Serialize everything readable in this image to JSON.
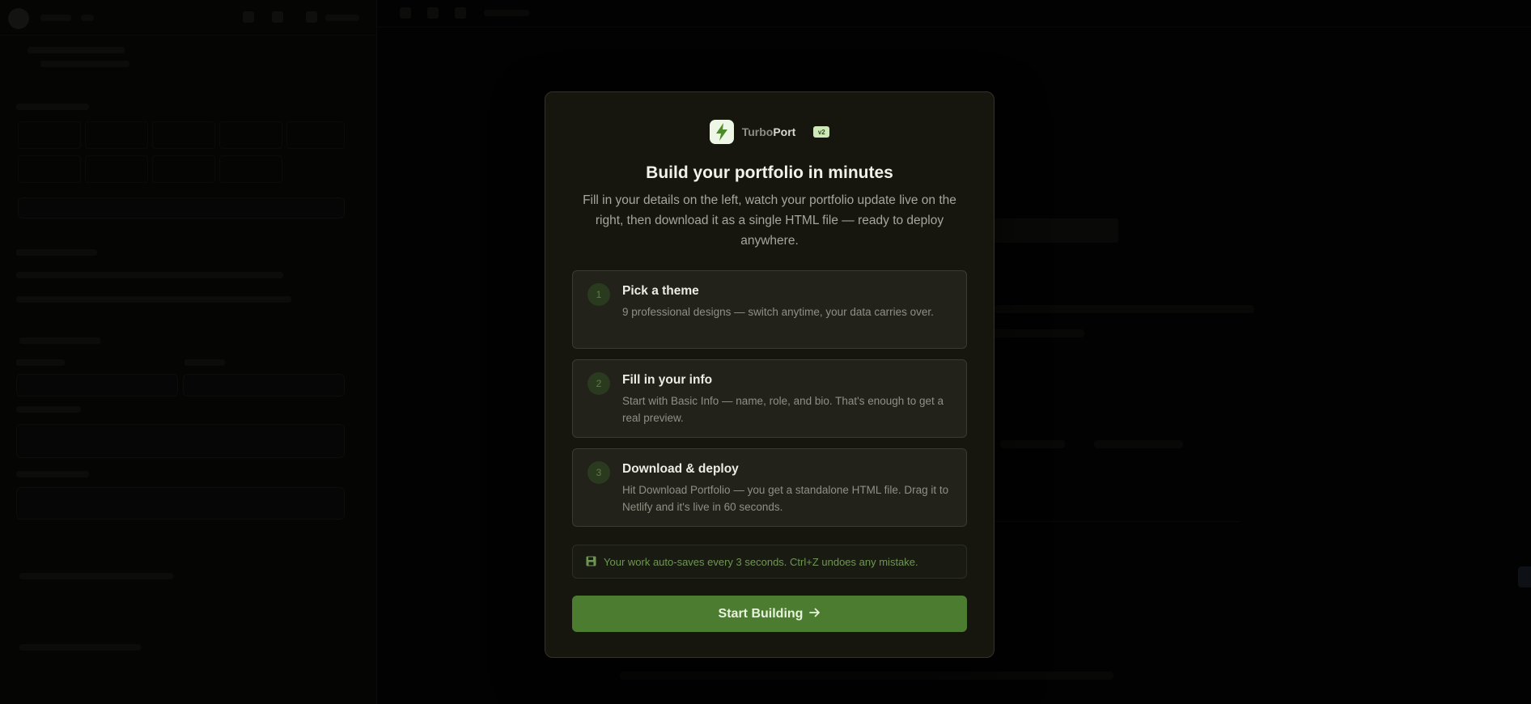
{
  "brand": {
    "name_part1": "Turbo",
    "name_part2": "Port",
    "badge": "v2",
    "logo_icon": "lightning-bolt-icon"
  },
  "modal": {
    "title": "Build your portfolio in minutes",
    "description": "Fill in your details on the left, watch your portfolio update live on the right, then download it as a single HTML file — ready to deploy anywhere."
  },
  "steps": [
    {
      "number": "1",
      "title": "Pick a theme",
      "text": "9 professional designs — switch anytime, your data carries over."
    },
    {
      "number": "2",
      "title": "Fill in your info",
      "text": "Start with Basic Info — name, role, and bio. That's enough to get a real preview."
    },
    {
      "number": "3",
      "title": "Download & deploy",
      "text": "Hit Download Portfolio — you get a standalone HTML file. Drag it to Netlify and it's live in 60 seconds."
    }
  ],
  "notice": {
    "icon": "floppy-disk-icon",
    "text": "Your work auto-saves every 3 seconds. Ctrl+Z undoes any mistake."
  },
  "cta": {
    "label": "Start Building",
    "icon": "arrow-right-icon"
  },
  "colors": {
    "accent": "#4c7c2f",
    "modal_bg": "#16160f",
    "notice_text": "#6f9554"
  }
}
